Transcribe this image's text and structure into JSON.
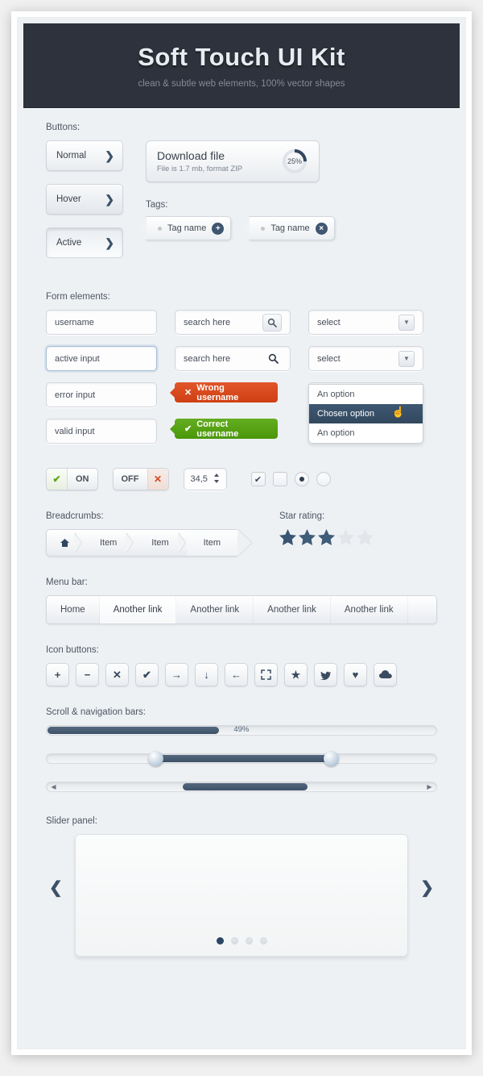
{
  "header": {
    "title": "Soft Touch UI Kit",
    "subtitle": "clean & subtle web elements, 100% vector shapes"
  },
  "sections": {
    "buttons": "Buttons:",
    "tags": "Tags:",
    "form": "Form elements:",
    "breadcrumbs": "Breadcrumbs:",
    "star_rating": "Star rating:",
    "menu_bar": "Menu bar:",
    "icon_buttons": "Icon buttons:",
    "scroll": "Scroll & navigation bars:",
    "slider": "Slider panel:"
  },
  "buttons": [
    {
      "label": "Normal",
      "state": "normal",
      "icon": "chevron-right-icon"
    },
    {
      "label": "Hover",
      "state": "hover",
      "icon": "chevron-right-icon"
    },
    {
      "label": "Active",
      "state": "active",
      "icon": "chevron-right-icon"
    }
  ],
  "download": {
    "title": "Download file",
    "meta": "File is 1.7 mb, format ZIP",
    "progress_label": "25%",
    "progress_value": 25
  },
  "tags": [
    {
      "label": "Tag name",
      "badge": "+",
      "badge_icon": "plus-circle-icon"
    },
    {
      "label": "Tag name",
      "badge": "×",
      "badge_icon": "close-circle-icon"
    }
  ],
  "form": {
    "text_inputs": [
      {
        "value": "username",
        "state": "normal"
      },
      {
        "value": "active input",
        "state": "focus"
      },
      {
        "value": "error input",
        "state": "error"
      },
      {
        "value": "valid input",
        "state": "valid"
      }
    ],
    "search_inputs": [
      {
        "value": "search here",
        "icon": "search-icon",
        "style": "button"
      },
      {
        "value": "search here",
        "icon": "search-icon",
        "style": "plain"
      }
    ],
    "selects": [
      {
        "value": "select",
        "state": "normal"
      },
      {
        "value": "select",
        "state": "normal"
      },
      {
        "value": "select",
        "state": "open"
      }
    ],
    "messages": [
      {
        "text": "Wrong username",
        "type": "error",
        "icon": "close-icon",
        "color": "#d2441a"
      },
      {
        "text": "Correct username",
        "type": "success",
        "icon": "check-icon",
        "color": "#55a012"
      }
    ],
    "dropdown_options": [
      {
        "label": "An option",
        "selected": false
      },
      {
        "label": "Chosen option",
        "selected": true
      },
      {
        "label": "An option",
        "selected": false
      }
    ],
    "toggles": [
      {
        "label": "ON",
        "state": "on",
        "icon": "check-icon"
      },
      {
        "label": "OFF",
        "state": "off",
        "icon": "close-icon"
      }
    ],
    "stepper": {
      "value": "34,5",
      "icon": "updown-arrows-icon"
    },
    "checkboxes": [
      {
        "checked": true,
        "icon": "check-icon"
      },
      {
        "checked": false
      }
    ],
    "radios": [
      {
        "selected": true
      },
      {
        "selected": false
      }
    ]
  },
  "breadcrumbs": {
    "home_icon": "home-icon",
    "items": [
      "Item",
      "Item",
      "Item"
    ]
  },
  "rating": {
    "value": 3,
    "max": 5
  },
  "menu": {
    "items": [
      {
        "label": "Home",
        "active": false
      },
      {
        "label": "Another link",
        "active": true
      },
      {
        "label": "Another link",
        "active": false
      },
      {
        "label": "Another link",
        "active": false
      },
      {
        "label": "Another link",
        "active": false
      }
    ]
  },
  "icon_buttons": [
    {
      "name": "plus-icon",
      "glyph": "+"
    },
    {
      "name": "minus-icon",
      "glyph": "−"
    },
    {
      "name": "close-icon",
      "glyph": "✕"
    },
    {
      "name": "check-icon",
      "glyph": "✔"
    },
    {
      "name": "arrow-right-icon",
      "glyph": "→"
    },
    {
      "name": "arrow-down-icon",
      "glyph": "↓"
    },
    {
      "name": "arrow-left-icon",
      "glyph": "←"
    },
    {
      "name": "fullscreen-icon",
      "glyph": "⛶"
    },
    {
      "name": "star-icon",
      "glyph": "★"
    },
    {
      "name": "bird-icon",
      "glyph": "🐦"
    },
    {
      "name": "heart-icon",
      "glyph": "♥"
    },
    {
      "name": "cloud-icon",
      "glyph": "☁"
    }
  ],
  "scrollbars": {
    "progress": {
      "value": 49,
      "label": "49%"
    },
    "range": {
      "start": 28,
      "end": 73
    },
    "scroll": {
      "thumb_start": 35,
      "thumb_end": 67,
      "left_icon": "arrow-left-icon",
      "right_icon": "arrow-right-icon"
    }
  },
  "slider_panel": {
    "dots": [
      true,
      false,
      false,
      false
    ],
    "prev_icon": "chevron-left-icon",
    "next_icon": "chevron-right-icon"
  },
  "colors": {
    "header_bg": "#2d323c",
    "accent": "#3c5168",
    "error": "#d2441a",
    "success": "#55a012",
    "page_bg": "#eef1f4"
  }
}
